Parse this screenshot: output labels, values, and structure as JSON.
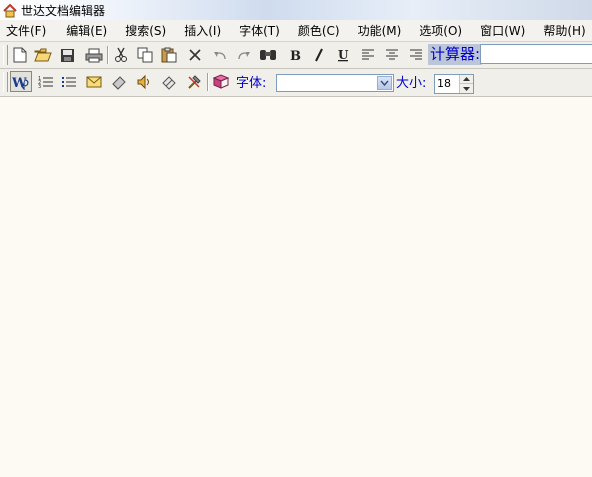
{
  "window": {
    "title": "世达文档编辑器"
  },
  "menu": [
    "文件(F)",
    "编辑(E)",
    "搜索(S)",
    "插入(I)",
    "字体(T)",
    "颜色(C)",
    "功能(M)",
    "选项(O)",
    "窗口(W)",
    "帮助(H)"
  ],
  "toolbar1": {
    "calculator_label": "计算器:",
    "calculator_value": ""
  },
  "toolbar2": {
    "font_label": "字体:",
    "font_value": "",
    "size_label": "大小:",
    "size_value": "18"
  },
  "icons": [
    "new-file-icon",
    "open-folder-icon",
    "save-icon",
    "print-icon",
    "cut-icon",
    "copy-icon",
    "paste-icon",
    "delete-icon",
    "undo-icon",
    "redo-icon",
    "find-binoculars-icon",
    "bold-icon",
    "italic-icon",
    "underline-icon",
    "align-left-icon",
    "align-center-icon",
    "align-right-icon",
    "word-wrap-icon",
    "numbered-list-icon",
    "bullet-list-icon",
    "mail-icon",
    "eraser-icon",
    "speaker-icon",
    "eraser-icon",
    "tools-icon",
    "book-icon"
  ]
}
